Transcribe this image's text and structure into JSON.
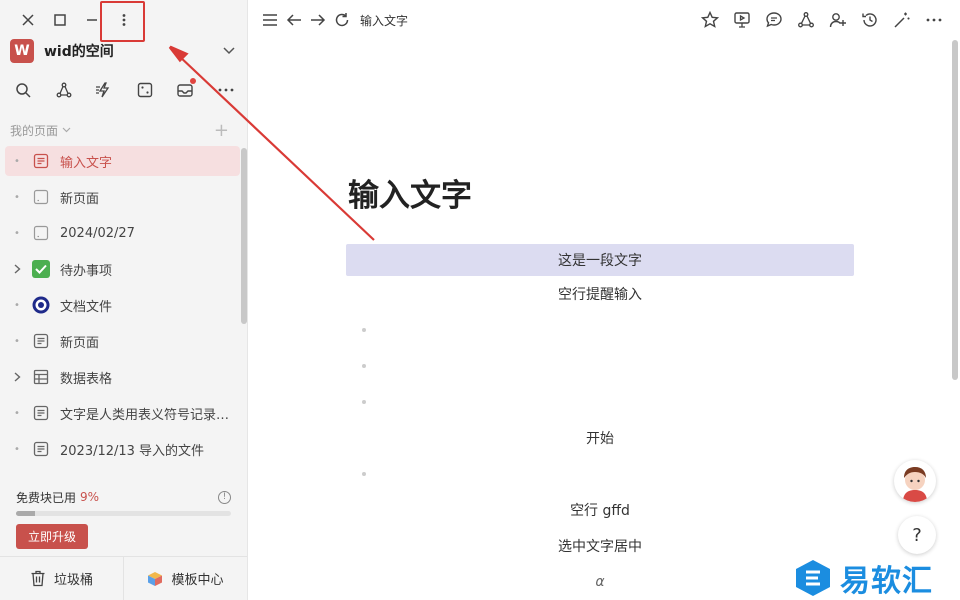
{
  "window": {
    "controls": [
      "close-icon",
      "maximize-icon",
      "minimize-icon",
      "more-vertical-icon"
    ]
  },
  "workspace": {
    "avatar_letter": "W",
    "name": "wid的空间"
  },
  "toolbar": {
    "icons": [
      "search-icon",
      "graph-icon",
      "flash-icon",
      "dice-icon",
      "inbox-icon",
      "more-icon"
    ]
  },
  "sidebar": {
    "section_title": "我的页面",
    "pages": [
      {
        "label": "输入文字",
        "icon": "doc-icon",
        "active": true
      },
      {
        "label": "新页面",
        "icon": "blank-page-icon"
      },
      {
        "label": "2024/02/27",
        "icon": "blank-page-icon"
      },
      {
        "label": "待办事项",
        "icon": "checkbox-icon",
        "expandable": true
      },
      {
        "label": "文档文件",
        "icon": "target-icon"
      },
      {
        "label": "新页面",
        "icon": "doc-icon"
      },
      {
        "label": "数据表格",
        "icon": "table-icon",
        "expandable": true
      },
      {
        "label": "文字是人类用表义符号记录…",
        "icon": "doc-icon"
      },
      {
        "label": "2023/12/13 导入的文件",
        "icon": "doc-icon"
      }
    ],
    "usage_label": "免费块已用",
    "usage_pct_label": "9%",
    "usage_fraction": 0.09,
    "upgrade_label": "立即升级",
    "trash_label": "垃圾桶",
    "template_label": "模板中心"
  },
  "topbar": {
    "breadcrumb": "输入文字"
  },
  "document": {
    "title": "输入文字",
    "lines": [
      "这是一段文字",
      "空行提醒输入",
      "",
      "",
      "",
      "开始",
      "",
      "空行 gffd",
      "选中文字居中",
      "α"
    ]
  },
  "colors": {
    "accent": "#c8514c",
    "selection": "#dcdcf1",
    "annotation": "#d93a36",
    "watermark": "#1b8de0"
  },
  "watermark": {
    "text": "易软汇"
  }
}
